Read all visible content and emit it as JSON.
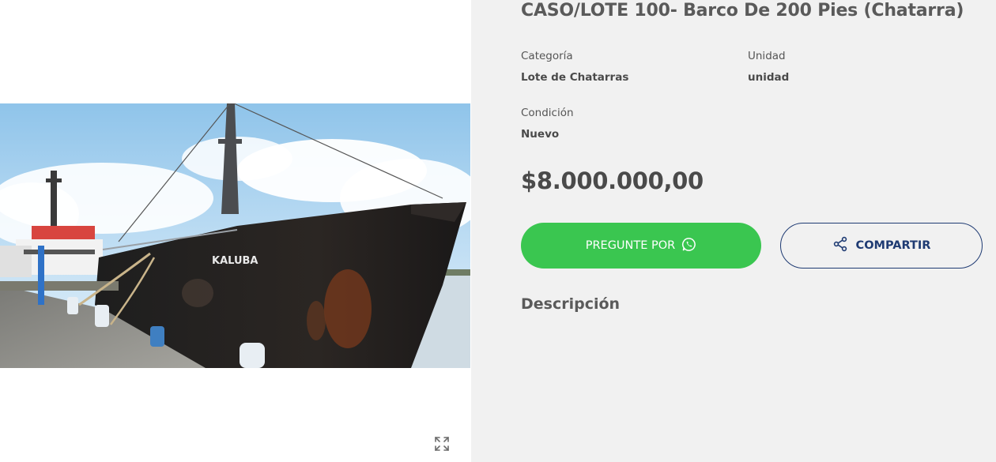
{
  "product": {
    "title": "CASO/LOTE 100- Barco De 200 Pies (Chatarra)",
    "image_hull_text": "KALUBA",
    "attributes": {
      "category_label": "Categoría",
      "category_value": "Lote de Chatarras",
      "unit_label": "Unidad",
      "unit_value": "unidad",
      "condition_label": "Condición",
      "condition_value": "Nuevo"
    },
    "price": "$8.000.000,00",
    "ask_button_label": "PREGUNTE POR",
    "share_button_label": "COMPARTIR",
    "description_heading": "Descripción"
  },
  "icons": {
    "ask": "whatsapp-icon",
    "share": "share-icon",
    "expand": "expand-icon"
  },
  "colors": {
    "ask_button": "#3ac650",
    "share_border": "#1f3b73",
    "info_panel_bg": "#f1f1f1",
    "text": "#4a4a4a"
  }
}
